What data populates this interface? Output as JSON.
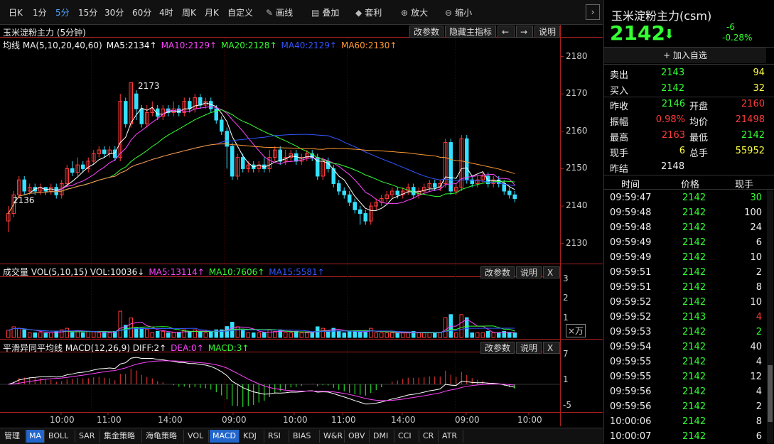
{
  "toolbar": {
    "periods": [
      {
        "label": "日K",
        "active": false
      },
      {
        "label": "1分",
        "active": false
      },
      {
        "label": "5分",
        "active": true
      },
      {
        "label": "15分",
        "active": false
      },
      {
        "label": "30分",
        "active": false
      },
      {
        "label": "60分",
        "active": false
      },
      {
        "label": "4时",
        "active": false
      },
      {
        "label": "周K",
        "active": false
      },
      {
        "label": "月K",
        "active": false
      },
      {
        "label": "自定义",
        "active": false
      }
    ],
    "tools": [
      {
        "label": "画线",
        "icon": "pen-icon"
      },
      {
        "label": "叠加",
        "icon": "stack-icon"
      },
      {
        "label": "套利",
        "icon": "bag-icon"
      },
      {
        "label": "放大",
        "icon": "zoom-in-icon"
      },
      {
        "label": "缩小",
        "icon": "zoom-out-icon"
      }
    ],
    "arrow": "›"
  },
  "main_chart": {
    "title": "玉米淀粉主力 (5分钟)",
    "buttons": [
      "改参数",
      "隐藏主指标",
      "←",
      "→",
      "说明"
    ],
    "legend": [
      {
        "text": "均线 MA(5,10,20,40,60)",
        "color": "#eeeeee"
      },
      {
        "text": "MA5:2134↑",
        "color": "#ffffff"
      },
      {
        "text": "MA10:2129↑",
        "color": "#ff44ff"
      },
      {
        "text": "MA20:2128↑",
        "color": "#33ff33"
      },
      {
        "text": "MA40:2129↑",
        "color": "#3355ff"
      },
      {
        "text": "MA60:2130↑",
        "color": "#ff9933"
      }
    ],
    "y_ticks": [
      "2180",
      "2170",
      "2160",
      "2150",
      "2140",
      "2130"
    ],
    "high_label": "2173",
    "low_label": "2136"
  },
  "volume_chart": {
    "legend": [
      {
        "text": "成交量 VOL(5,10,15) VOL:10036↓",
        "color": "#eeeeee"
      },
      {
        "text": "MA5:13114↑",
        "color": "#ff44ff"
      },
      {
        "text": "MA10:7606↑",
        "color": "#33ff33"
      },
      {
        "text": "MA15:5581↑",
        "color": "#3355ff"
      }
    ],
    "buttons": [
      "改参数",
      "说明",
      "X"
    ],
    "y_ticks": [
      "3",
      "2",
      "1"
    ],
    "unit_label": "×万"
  },
  "macd_chart": {
    "legend": [
      {
        "text": "平滑异同平均线 MACD(12,26,9) DIFF:2↑",
        "color": "#eeeeee"
      },
      {
        "text": "DEA:0↑",
        "color": "#ff44ff"
      },
      {
        "text": "MACD:3↑",
        "color": "#33ff33"
      }
    ],
    "buttons": [
      "改参数",
      "说明",
      "X"
    ],
    "y_ticks": [
      "7",
      "1",
      "-5"
    ]
  },
  "x_ticks": [
    "10:00",
    "11:00",
    "14:00",
    "09:00",
    "10:00",
    "11:00",
    "14:00",
    "09:00",
    "10:00"
  ],
  "bottom_tabs": [
    {
      "label": "管理",
      "active": false
    },
    {
      "label": "MA",
      "active": true
    },
    {
      "label": "BOLL",
      "active": false
    },
    {
      "label": "SAR",
      "active": false
    },
    {
      "label": "集金策略",
      "active": false
    },
    {
      "label": "海龟策略",
      "active": false
    },
    {
      "label": "VOL",
      "active": false
    },
    {
      "label": "MACD",
      "active": true
    },
    {
      "label": "KDJ",
      "active": false
    },
    {
      "label": "RSI",
      "active": false
    },
    {
      "label": "BIAS",
      "active": false
    },
    {
      "label": "W&R",
      "active": false
    },
    {
      "label": "OBV",
      "active": false
    },
    {
      "label": "DMI",
      "active": false
    },
    {
      "label": "CCI",
      "active": false
    },
    {
      "label": "CR",
      "active": false
    },
    {
      "label": "ATR",
      "active": false
    }
  ],
  "quote": {
    "name": "玉米淀粉主力(csm)",
    "price": "2142",
    "arrow": "⬇",
    "change": "-6",
    "change_pct": "-0.28%",
    "add_watch": "+ 加入自选",
    "sell_label": "卖出",
    "sell_price": "2143",
    "sell_vol": "94",
    "buy_label": "买入",
    "buy_price": "2142",
    "buy_vol": "32",
    "stats": [
      {
        "l1": "昨收",
        "v1": "2146",
        "c1": "green",
        "l2": "开盘",
        "v2": "2160",
        "c2": "red"
      },
      {
        "l1": "振幅",
        "v1": "0.98%",
        "c1": "red",
        "l2": "均价",
        "v2": "21498",
        "c2": "red"
      },
      {
        "l1": "最高",
        "v1": "2163",
        "c1": "red",
        "l2": "最低",
        "v2": "2142",
        "c2": "green"
      },
      {
        "l1": "现手",
        "v1": "6",
        "c1": "yellow",
        "l2": "总手",
        "v2": "55952",
        "c2": "yellow"
      }
    ],
    "settle_label": "昨结",
    "settle_value": "2148",
    "trade_headers": [
      "时间",
      "价格",
      "现手"
    ],
    "trades": [
      {
        "time": "09:59:47",
        "price": "2142",
        "vol": "30",
        "vcolor": "green"
      },
      {
        "time": "09:59:48",
        "price": "2142",
        "vol": "100",
        "vcolor": "white"
      },
      {
        "time": "09:59:48",
        "price": "2142",
        "vol": "24",
        "vcolor": "white"
      },
      {
        "time": "09:59:49",
        "price": "2142",
        "vol": "6",
        "vcolor": "white"
      },
      {
        "time": "09:59:49",
        "price": "2142",
        "vol": "10",
        "vcolor": "white"
      },
      {
        "time": "09:59:51",
        "price": "2142",
        "vol": "2",
        "vcolor": "white"
      },
      {
        "time": "09:59:51",
        "price": "2142",
        "vol": "8",
        "vcolor": "white"
      },
      {
        "time": "09:59:52",
        "price": "2142",
        "vol": "10",
        "vcolor": "white"
      },
      {
        "time": "09:59:52",
        "price": "2143",
        "vol": "4",
        "vcolor": "red"
      },
      {
        "time": "09:59:53",
        "price": "2142",
        "vol": "2",
        "vcolor": "green"
      },
      {
        "time": "09:59:54",
        "price": "2142",
        "vol": "40",
        "vcolor": "white"
      },
      {
        "time": "09:59:55",
        "price": "2142",
        "vol": "4",
        "vcolor": "white"
      },
      {
        "time": "09:59:55",
        "price": "2142",
        "vol": "12",
        "vcolor": "white"
      },
      {
        "time": "09:59:56",
        "price": "2142",
        "vol": "4",
        "vcolor": "white"
      },
      {
        "time": "09:59:56",
        "price": "2142",
        "vol": "2",
        "vcolor": "white"
      },
      {
        "time": "10:00:06",
        "price": "2142",
        "vol": "8",
        "vcolor": "white"
      },
      {
        "time": "10:00:07",
        "price": "2142",
        "vol": "6",
        "vcolor": "white"
      }
    ]
  },
  "colors": {
    "up": "#ff3b3b",
    "down": "#33e0ff",
    "axis": "#aa2222",
    "grid": "#3a0000"
  },
  "chart_data": {
    "type": "candlestick",
    "price_ylim": [
      2125,
      2182
    ],
    "candles": [
      [
        2136,
        2138,
        2133,
        2140
      ],
      [
        2138,
        2143,
        2137,
        2144
      ],
      [
        2143,
        2147,
        2142,
        2148
      ],
      [
        2147,
        2144,
        2143,
        2148
      ],
      [
        2144,
        2145,
        2143,
        2146
      ],
      [
        2145,
        2144,
        2143,
        2146
      ],
      [
        2144,
        2145,
        2143,
        2146
      ],
      [
        2145,
        2144,
        2143,
        2145
      ],
      [
        2144,
        2145,
        2143,
        2146
      ],
      [
        2145,
        2143,
        2142,
        2146
      ],
      [
        2143,
        2146,
        2142,
        2147
      ],
      [
        2146,
        2150,
        2145,
        2151
      ],
      [
        2150,
        2149,
        2148,
        2152
      ],
      [
        2149,
        2151,
        2148,
        2153
      ],
      [
        2151,
        2150,
        2149,
        2152
      ],
      [
        2150,
        2152,
        2149,
        2153
      ],
      [
        2152,
        2154,
        2151,
        2155
      ],
      [
        2154,
        2155,
        2153,
        2156
      ],
      [
        2155,
        2154,
        2153,
        2156
      ],
      [
        2154,
        2155,
        2153,
        2156
      ],
      [
        2155,
        2153,
        2152,
        2156
      ],
      [
        2153,
        2168,
        2152,
        2170
      ],
      [
        2168,
        2162,
        2161,
        2169
      ],
      [
        2162,
        2173,
        2161,
        2173
      ],
      [
        2170,
        2166,
        2163,
        2171
      ],
      [
        2166,
        2162,
        2161,
        2167
      ],
      [
        2162,
        2165,
        2161,
        2167
      ],
      [
        2165,
        2166,
        2164,
        2168
      ],
      [
        2166,
        2164,
        2163,
        2167
      ],
      [
        2164,
        2166,
        2163,
        2167
      ],
      [
        2166,
        2165,
        2164,
        2167
      ],
      [
        2165,
        2166,
        2164,
        2168
      ],
      [
        2166,
        2165,
        2164,
        2167
      ],
      [
        2165,
        2168,
        2164,
        2169
      ],
      [
        2168,
        2166,
        2165,
        2169
      ],
      [
        2166,
        2169,
        2165,
        2170
      ],
      [
        2169,
        2167,
        2166,
        2170
      ],
      [
        2167,
        2168,
        2166,
        2169
      ],
      [
        2168,
        2166,
        2165,
        2169
      ],
      [
        2166,
        2163,
        2162,
        2167
      ],
      [
        2163,
        2160,
        2159,
        2164
      ],
      [
        2160,
        2156,
        2150,
        2161
      ],
      [
        2156,
        2148,
        2147,
        2157
      ],
      [
        2148,
        2153,
        2147,
        2154
      ],
      [
        2153,
        2150,
        2149,
        2154
      ],
      [
        2150,
        2151,
        2149,
        2152
      ],
      [
        2151,
        2150,
        2149,
        2152
      ],
      [
        2150,
        2151,
        2149,
        2152
      ],
      [
        2151,
        2150,
        2149,
        2153
      ],
      [
        2150,
        2153,
        2149,
        2155
      ],
      [
        2153,
        2155,
        2152,
        2156
      ],
      [
        2155,
        2152,
        2151,
        2156
      ],
      [
        2152,
        2153,
        2151,
        2155
      ],
      [
        2153,
        2154,
        2152,
        2155
      ],
      [
        2154,
        2152,
        2151,
        2155
      ],
      [
        2152,
        2153,
        2151,
        2154
      ],
      [
        2153,
        2154,
        2152,
        2155
      ],
      [
        2154,
        2153,
        2152,
        2155
      ],
      [
        2153,
        2148,
        2147,
        2154
      ],
      [
        2148,
        2152,
        2147,
        2153
      ],
      [
        2152,
        2150,
        2149,
        2153
      ],
      [
        2150,
        2146,
        2145,
        2151
      ],
      [
        2146,
        2144,
        2143,
        2147
      ],
      [
        2144,
        2143,
        2142,
        2145
      ],
      [
        2143,
        2141,
        2140,
        2144
      ],
      [
        2141,
        2139,
        2138,
        2142
      ],
      [
        2139,
        2138,
        2135,
        2140
      ],
      [
        2138,
        2136,
        2135,
        2139
      ],
      [
        2136,
        2140,
        2135,
        2141
      ],
      [
        2140,
        2141,
        2139,
        2142
      ],
      [
        2141,
        2142,
        2140,
        2143
      ],
      [
        2142,
        2143,
        2141,
        2144
      ],
      [
        2143,
        2144,
        2142,
        2145
      ],
      [
        2144,
        2143,
        2142,
        2145
      ],
      [
        2143,
        2144,
        2142,
        2145
      ],
      [
        2144,
        2145,
        2143,
        2146
      ],
      [
        2145,
        2143,
        2142,
        2146
      ],
      [
        2143,
        2144,
        2142,
        2145
      ],
      [
        2144,
        2145,
        2143,
        2146
      ],
      [
        2145,
        2146,
        2144,
        2147
      ],
      [
        2146,
        2145,
        2144,
        2147
      ],
      [
        2145,
        2146,
        2144,
        2147
      ],
      [
        2146,
        2157,
        2145,
        2158
      ],
      [
        2157,
        2144,
        2143,
        2158
      ],
      [
        2144,
        2145,
        2143,
        2146
      ],
      [
        2145,
        2158,
        2144,
        2159
      ],
      [
        2158,
        2147,
        2146,
        2159
      ],
      [
        2147,
        2146,
        2145,
        2148
      ],
      [
        2146,
        2147,
        2145,
        2148
      ],
      [
        2147,
        2148,
        2146,
        2149
      ],
      [
        2148,
        2146,
        2145,
        2149
      ],
      [
        2146,
        2147,
        2145,
        2148
      ],
      [
        2147,
        2146,
        2145,
        2148
      ],
      [
        2146,
        2144,
        2143,
        2147
      ],
      [
        2144,
        2143,
        2142,
        2145
      ],
      [
        2143,
        2142,
        2141,
        2144
      ]
    ],
    "volume_ylim": [
      0,
      3.2
    ],
    "macd_ylim": [
      -6,
      8
    ]
  }
}
